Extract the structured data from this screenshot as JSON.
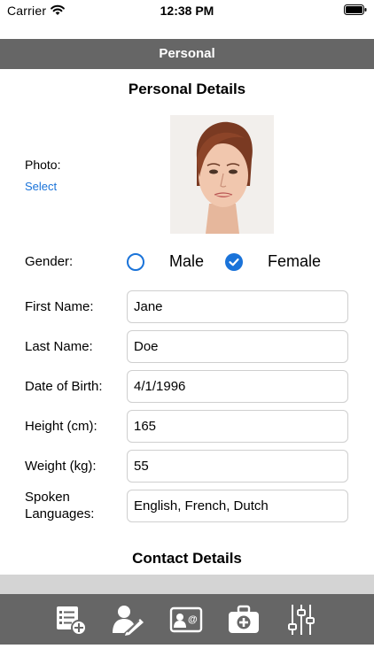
{
  "status_bar": {
    "carrier": "Carrier",
    "time": "12:38 PM"
  },
  "nav": {
    "title": "Personal"
  },
  "sections": {
    "personal_title": "Personal Details",
    "contact_title": "Contact Details"
  },
  "photo": {
    "label": "Photo:",
    "select_label": "Select"
  },
  "gender": {
    "label": "Gender:",
    "options": [
      "Male",
      "Female"
    ],
    "selected": "Female"
  },
  "fields": {
    "first_name": {
      "label": "First Name:",
      "value": "Jane"
    },
    "last_name": {
      "label": "Last Name:",
      "value": "Doe"
    },
    "dob": {
      "label": "Date of Birth:",
      "value": "4/1/1996"
    },
    "height": {
      "label": "Height (cm):",
      "value": "165"
    },
    "weight": {
      "label": "Weight (kg):",
      "value": "55"
    },
    "languages": {
      "label_line1": "Spoken",
      "label_line2": "Languages:",
      "value": "English, French, Dutch"
    }
  },
  "tabs": [
    {
      "icon": "add-record-icon"
    },
    {
      "icon": "edit-profile-icon"
    },
    {
      "icon": "contact-card-icon"
    },
    {
      "icon": "medical-kit-icon"
    },
    {
      "icon": "settings-sliders-icon"
    }
  ],
  "colors": {
    "accent": "#1a73d9",
    "bar": "#666666",
    "strip": "#d4d4d4"
  }
}
